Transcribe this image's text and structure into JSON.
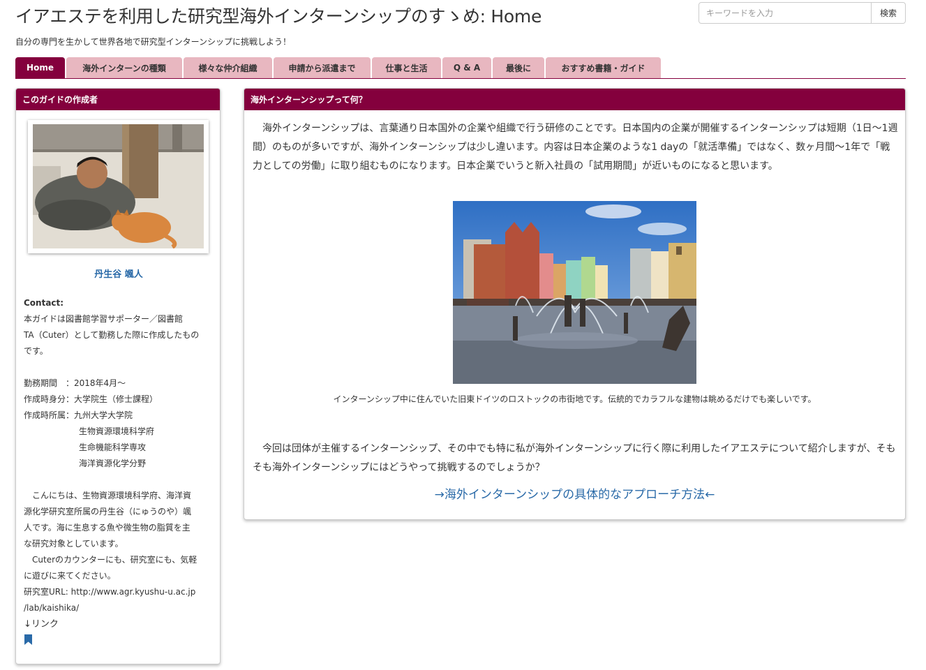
{
  "header": {
    "title": "イアエステを利用した研究型海外インターンシップのすゝめ: Home",
    "subtitle": "自分の専門を生かして世界各地で研究型インターンシップに挑戦しよう！"
  },
  "search": {
    "placeholder": "キーワードを入力",
    "button_label": "検索"
  },
  "tabs": [
    {
      "label": "Home",
      "active": true
    },
    {
      "label": "海外インターンの種類"
    },
    {
      "label": "様々な仲介組織"
    },
    {
      "label": "申請から派遣まで"
    },
    {
      "label": "仕事と生活"
    },
    {
      "label": "Q & A"
    },
    {
      "label": "最後に"
    },
    {
      "label": "おすすめ書籍・ガイド"
    }
  ],
  "sidebar": {
    "header": "このガイドの作成者",
    "author_name": "丹生谷 颯人",
    "contact_label": "Contact:",
    "contact_lines": [
      "本ガイドは図書館学習サポーター／図書館",
      "TA（Cuter）として勤務した際に作成したもの",
      "です。"
    ],
    "details": [
      "勤務期間　：2018年4月～",
      "作成時身分：大学院生（修士課程）",
      "作成時所属：九州大学大学院"
    ],
    "affiliation_lines": [
      "生物資源環境科学府",
      "生命機能科学専攻",
      "海洋資源化学分野"
    ],
    "intro_lines": [
      "こんにちは、生物資源環境科学府、海洋資",
      "源化学研究室所属の丹生谷（にゅうのや）颯",
      "人です。海に生息する魚や微生物の脂質を主",
      "な研究対象としています。"
    ],
    "invite_lines": [
      "Cuterのカウンターにも、研究室にも、気軽",
      "に遊びに来てください。"
    ],
    "lab_url_lines": [
      "研究室URL: http://www.agr.kyushu-u.ac.jp",
      "/lab/kaishika/"
    ],
    "link_label": "↓リンク",
    "bookmark_icon": "bookmark-icon"
  },
  "main": {
    "header": "海外インターンシップって何？",
    "intro": "海外インターンシップは、言葉通り日本国外の企業や組織で行う研修のことです。日本国内の企業が開催するインターンシップは短期（1日～1週間）のものが多いですが、海外インターンシップは少し違います。内容は日本企業のような1 dayの「就活準備」ではなく、数ヶ月間～1年で「戦力としての労働」に取り組むものになります。日本企業でいうと新入社員の「試用期間」が近いものになると思います。",
    "caption": "インターンシップ中に住んでいた旧東ドイツのロストックの市街地です。伝統的でカラフルな建物は眺めるだけでも楽しいです。",
    "para2": "今回は団体が主催するインターンシップ、その中でも特に私が海外インターンシップに行く際に利用したイアエステについて紹介しますが、そもそも海外インターンシップにはどうやって挑戦するのでしょうか？",
    "link": "→海外インターンシップの具体的なアプローチ方法←"
  },
  "colors": {
    "accent": "#84003d",
    "tab_inactive": "#e8b7c0",
    "link": "#2a6aa8"
  }
}
